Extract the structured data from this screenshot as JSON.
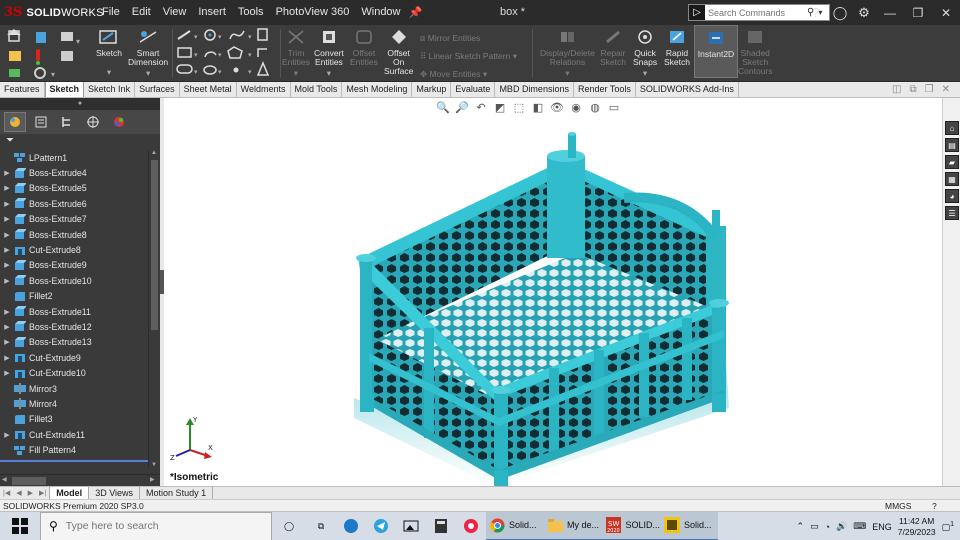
{
  "titlebar": {
    "logo_ds": "3S",
    "logo_brand": "SOLID",
    "logo_brand2": "WORKS",
    "menu": [
      "File",
      "Edit",
      "View",
      "Insert",
      "Tools",
      "PhotoView 360",
      "Window"
    ],
    "doc_title": "box *",
    "search_placeholder": "Search Commands"
  },
  "ribbon": {
    "sketch": "Sketch",
    "smart_dimension_1": "Smart",
    "smart_dimension_2": "Dimension",
    "trim_1": "Trim",
    "trim_2": "Entities",
    "convert_1": "Convert",
    "convert_2": "Entities",
    "offset_1": "Offset",
    "offset_2": "Entities",
    "offset_surface_1": "Offset",
    "offset_surface_2": "On",
    "offset_surface_3": "Surface",
    "mirror_entities": "Mirror Entities",
    "linear_pattern": "Linear Sketch Pattern",
    "move_entities": "Move Entities",
    "display_delete_1": "Display/Delete",
    "display_delete_2": "Relations",
    "repair_1": "Repair",
    "repair_2": "Sketch",
    "quick_snaps_1": "Quick",
    "quick_snaps_2": "Snaps",
    "rapid_1": "Rapid",
    "rapid_2": "Sketch",
    "instant2d": "Instant2D",
    "shaded_1": "Shaded",
    "shaded_2": "Sketch",
    "shaded_3": "Contours"
  },
  "command_tabs": [
    "Features",
    "Sketch",
    "Sketch Ink",
    "Surfaces",
    "Sheet Metal",
    "Weldments",
    "Mold Tools",
    "Mesh Modeling",
    "Markup",
    "Evaluate",
    "MBD Dimensions",
    "Render Tools",
    "SOLIDWORKS Add-Ins"
  ],
  "active_command_tab": "Sketch",
  "tree": [
    {
      "label": "LPattern1",
      "expandable": false,
      "icon": "pattern"
    },
    {
      "label": "Boss-Extrude4",
      "expandable": true,
      "icon": "boss"
    },
    {
      "label": "Boss-Extrude5",
      "expandable": true,
      "icon": "boss"
    },
    {
      "label": "Boss-Extrude6",
      "expandable": true,
      "icon": "boss"
    },
    {
      "label": "Boss-Extrude7",
      "expandable": true,
      "icon": "boss"
    },
    {
      "label": "Boss-Extrude8",
      "expandable": true,
      "icon": "boss"
    },
    {
      "label": "Cut-Extrude8",
      "expandable": true,
      "icon": "cut"
    },
    {
      "label": "Boss-Extrude9",
      "expandable": true,
      "icon": "boss"
    },
    {
      "label": "Boss-Extrude10",
      "expandable": true,
      "icon": "boss"
    },
    {
      "label": "Fillet2",
      "expandable": false,
      "icon": "fillet"
    },
    {
      "label": "Boss-Extrude11",
      "expandable": true,
      "icon": "boss"
    },
    {
      "label": "Boss-Extrude12",
      "expandable": true,
      "icon": "boss"
    },
    {
      "label": "Boss-Extrude13",
      "expandable": true,
      "icon": "boss"
    },
    {
      "label": "Cut-Extrude9",
      "expandable": true,
      "icon": "cut"
    },
    {
      "label": "Cut-Extrude10",
      "expandable": true,
      "icon": "cut"
    },
    {
      "label": "Mirror3",
      "expandable": false,
      "icon": "mirror"
    },
    {
      "label": "Mirror4",
      "expandable": false,
      "icon": "mirror"
    },
    {
      "label": "Fillet3",
      "expandable": false,
      "icon": "fillet"
    },
    {
      "label": "Cut-Extrude11",
      "expandable": true,
      "icon": "cut"
    },
    {
      "label": "Fill Pattern4",
      "expandable": false,
      "icon": "pattern"
    }
  ],
  "viewport": {
    "view_label": "*Isometric",
    "model_color": "#2bb5c4"
  },
  "bottom_tabs": [
    "Model",
    "3D Views",
    "Motion Study 1"
  ],
  "active_bottom_tab": "Model",
  "status": {
    "text": "SOLIDWORKS Premium 2020 SP3.0",
    "units": "MMGS",
    "help": "?"
  },
  "taskbar": {
    "search_placeholder": "Type here to search",
    "app_chrome": "Solid...",
    "app_folder": "My de...",
    "app_sw2020": "SOLID...",
    "app_sw2020_badge": "2020",
    "app_sw_other": "Solid...",
    "lang": "ENG",
    "time": "11:42 AM",
    "date": "7/29/2023",
    "notifications": "1"
  }
}
